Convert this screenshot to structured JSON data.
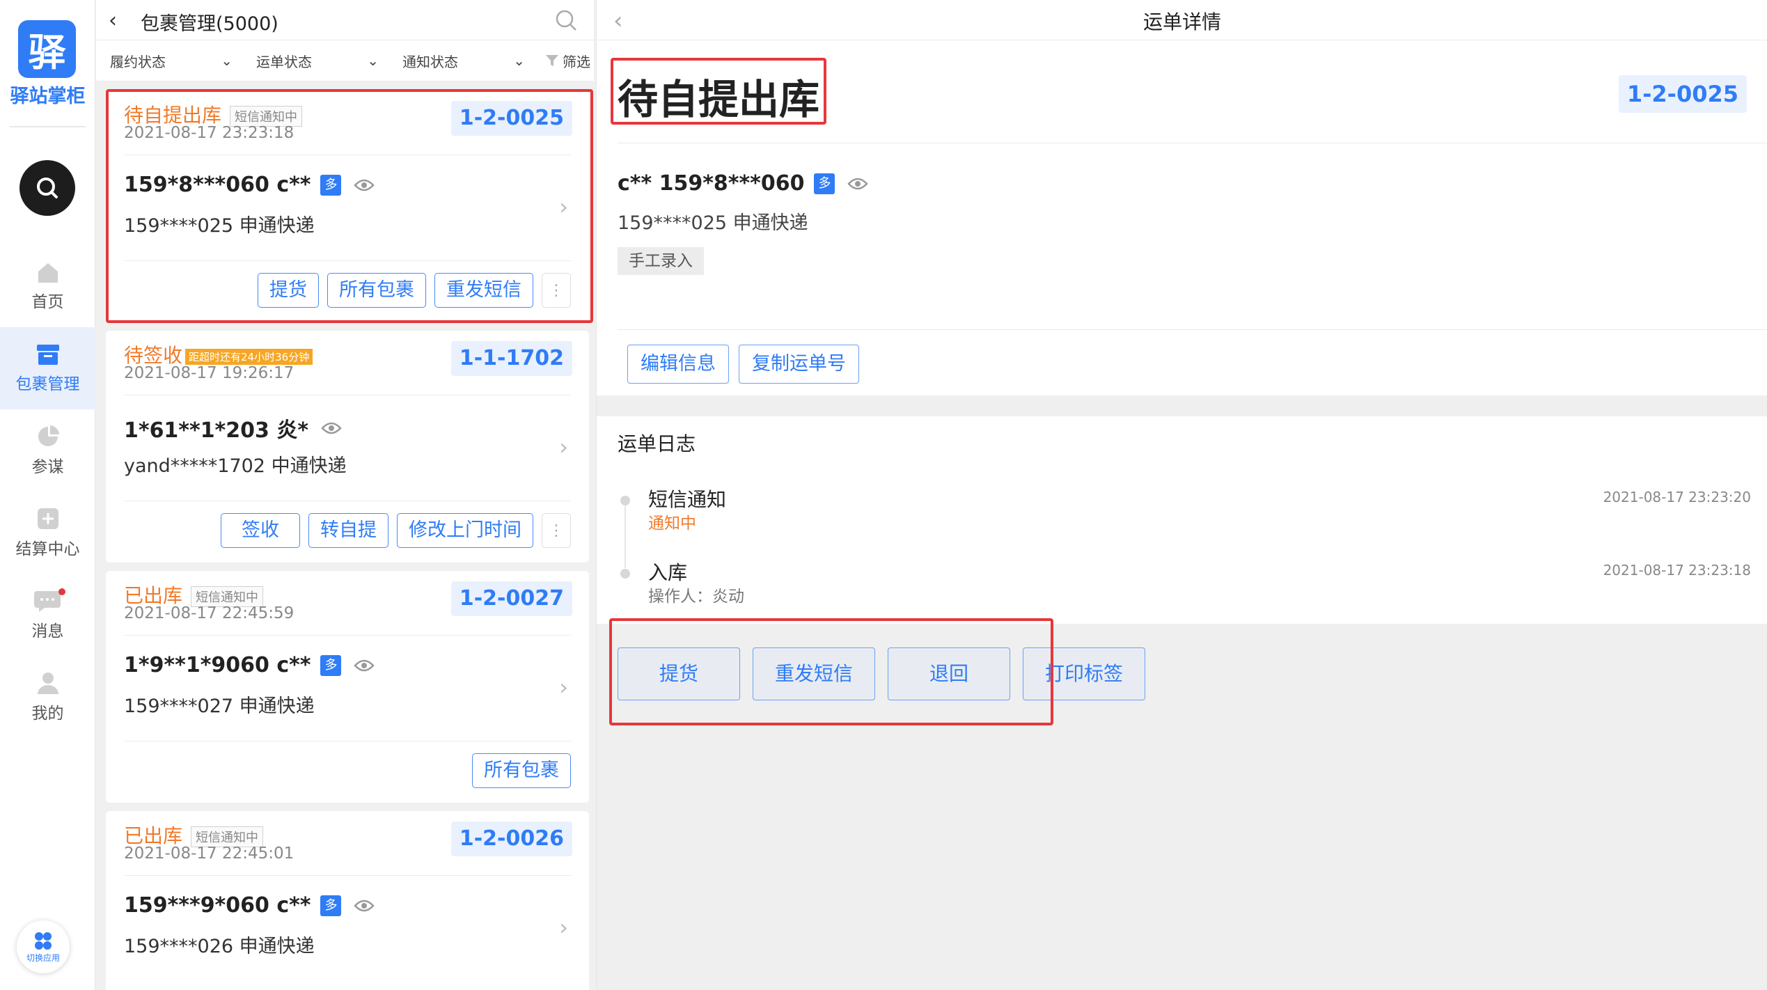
{
  "sidebar": {
    "logo_char": "驿",
    "app_name": "驿站掌柜",
    "items": [
      {
        "label": "首页"
      },
      {
        "label": "包裹管理"
      },
      {
        "label": "参谋"
      },
      {
        "label": "结算中心"
      },
      {
        "label": "消息"
      },
      {
        "label": "我的"
      }
    ],
    "switch_app": "切换应用",
    "accent": "#2f7cf6"
  },
  "list": {
    "title": "包裹管理(5000)",
    "filters": [
      {
        "label": "履约状态"
      },
      {
        "label": "运单状态"
      },
      {
        "label": "通知状态"
      }
    ],
    "filter_button": "筛选",
    "cards": [
      {
        "status": "待自提出库",
        "tag": "短信通知中",
        "time": "2021-08-17 23:23:18",
        "code": "1-2-0025",
        "name": "159*8***060  c**",
        "multi": "多",
        "sub": "159****025  申通快递",
        "buttons": [
          "提货",
          "所有包裹",
          "重发短信"
        ]
      },
      {
        "status": "待签收",
        "tag": "距超时还有24小时36分钟",
        "time": "2021-08-17 19:26:17",
        "code": "1-1-1702",
        "name": "1*61**1*203  炎*",
        "sub": "yand*****1702  中通快递",
        "buttons": [
          "签收",
          "转自提",
          "修改上门时间"
        ]
      },
      {
        "status": "已出库",
        "tag": "短信通知中",
        "time": "2021-08-17 22:45:59",
        "code": "1-2-0027",
        "name": "1*9**1*9060  c**",
        "multi": "多",
        "sub": "159****027  申通快递",
        "buttons": [
          "所有包裹"
        ]
      },
      {
        "status": "已出库",
        "tag": "短信通知中",
        "time": "2021-08-17 22:45:01",
        "code": "1-2-0026",
        "name": "159***9*060  c**",
        "multi": "多",
        "sub": "159****026  申通快递"
      }
    ]
  },
  "detail": {
    "title": "运单详情",
    "status": "待自提出库",
    "code": "1-2-0025",
    "name": "c**  159*8***060",
    "multi": "多",
    "sub": "159****025  申通快递",
    "source_tag": "手工录入",
    "buttons": [
      "编辑信息",
      "复制运单号"
    ],
    "log": {
      "title": "运单日志",
      "entries": [
        {
          "event": "短信通知",
          "status": "通知中",
          "time": "2021-08-17 23:23:20"
        },
        {
          "event": "入库",
          "operator": "操作人：炎动",
          "time": "2021-08-17 23:23:18"
        }
      ]
    },
    "actions": [
      "提货",
      "重发短信",
      "退回",
      "打印标签"
    ]
  }
}
